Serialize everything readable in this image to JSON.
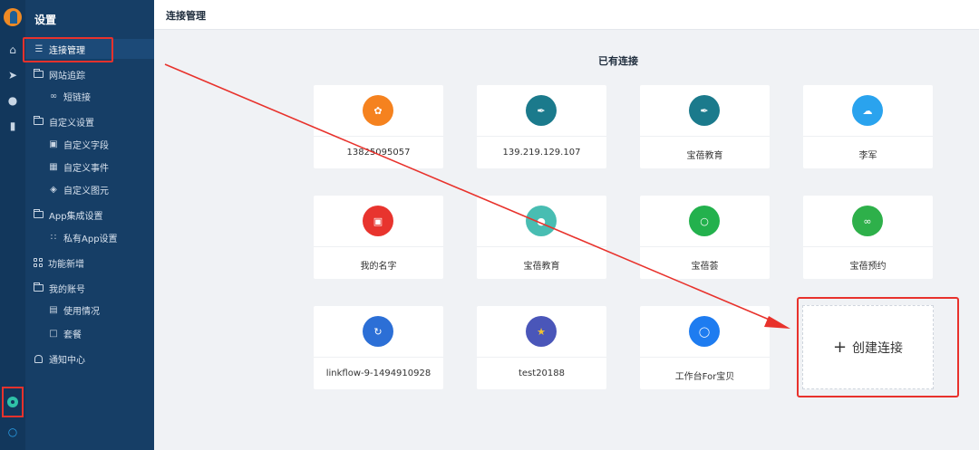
{
  "sidebar": {
    "title": "设置",
    "items": [
      {
        "label": "连接管理"
      },
      {
        "label": "网站追踪"
      },
      {
        "label": "短链接"
      },
      {
        "label": "自定义设置"
      },
      {
        "label": "自定义字段"
      },
      {
        "label": "自定义事件"
      },
      {
        "label": "自定义图元"
      },
      {
        "label": "App集成设置"
      },
      {
        "label": "私有App设置"
      },
      {
        "label": "功能新增"
      },
      {
        "label": "我的账号"
      },
      {
        "label": "使用情况"
      },
      {
        "label": "套餐"
      },
      {
        "label": "通知中心"
      }
    ]
  },
  "header": {
    "title": "连接管理"
  },
  "main": {
    "section_title": "已有连接",
    "connections": [
      {
        "label": "13825095057",
        "icon": "robot-icon",
        "color": "#f5821f"
      },
      {
        "label": "139.219.129.107",
        "icon": "feather-icon",
        "color": "#1b7a8c"
      },
      {
        "label": "宝蓓教育",
        "icon": "feather-icon",
        "color": "#1b7a8c"
      },
      {
        "label": "李军",
        "icon": "cloud-icon",
        "color": "#2aa3ee"
      },
      {
        "label": "我的名字",
        "icon": "tag-icon",
        "color": "#e8342e"
      },
      {
        "label": "宝蓓教育",
        "icon": "person-icon",
        "color": "#48bdb2"
      },
      {
        "label": "宝蓓荟",
        "icon": "wechat-icon",
        "color": "#23b14d"
      },
      {
        "label": "宝蓓预约",
        "icon": "link-icon",
        "color": "#2eb04a"
      },
      {
        "label": "linkflow-9-1494910928",
        "icon": "flow-icon",
        "color": "#2c6fd6"
      },
      {
        "label": "test20188",
        "icon": "star-icon",
        "color": "#4a56b9"
      },
      {
        "label": "工作台For宝贝",
        "icon": "chat-icon",
        "color": "#1e7cf0"
      }
    ],
    "create_label": "创建连接"
  },
  "colors": {
    "rail": "#12375c",
    "sidebar": "#163e66",
    "highlight": "#e8322c"
  }
}
